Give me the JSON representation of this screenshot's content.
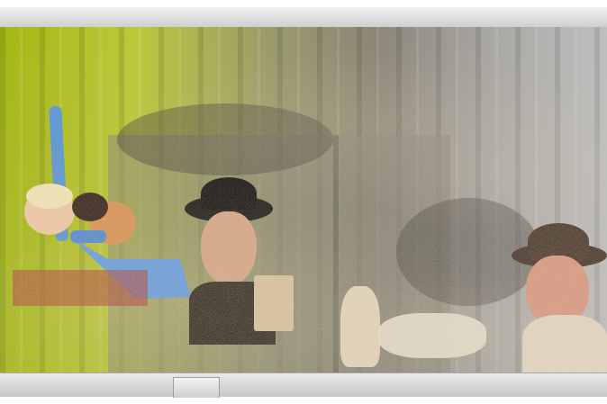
{
  "scene": {
    "description_colors": {
      "green_wall": "#a4b814",
      "sand": "#b09a70",
      "frame": "#d0d0d0"
    }
  }
}
